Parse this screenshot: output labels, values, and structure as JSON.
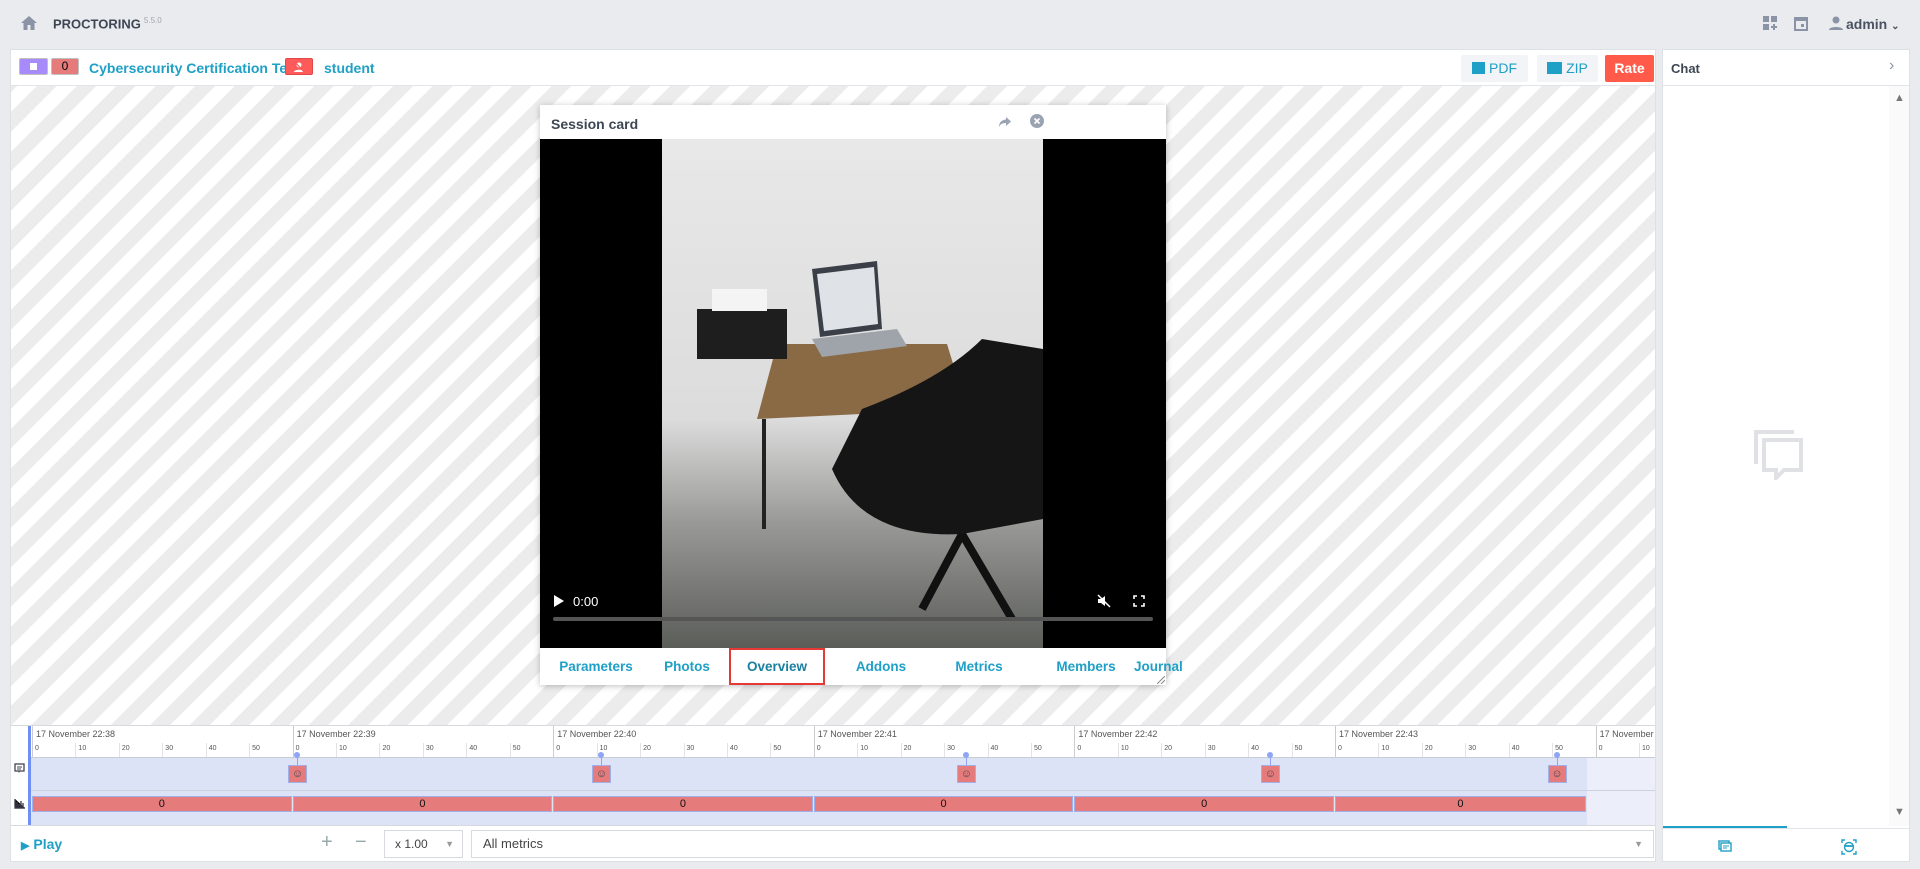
{
  "topbar": {
    "brand": "PROCTORING",
    "version": "5.5.0",
    "user": "admin"
  },
  "header": {
    "status_badge": "",
    "warnings_count": "0",
    "test_title": "Cybersecurity Certification Test",
    "student": "student",
    "pdf_label": "PDF",
    "zip_label": "ZIP",
    "rate_label": "Rate"
  },
  "session_card": {
    "title": "Session card",
    "video_time": "0:00",
    "tabs": [
      {
        "label": "Parameters"
      },
      {
        "label": "Photos"
      },
      {
        "label": "Overview",
        "active": true
      },
      {
        "label": "Addons"
      },
      {
        "label": "Metrics"
      },
      {
        "label": "Members"
      },
      {
        "label": "Journal"
      }
    ]
  },
  "timeline": {
    "minutes": [
      "17 November 22:38",
      "17 November 22:39",
      "17 November 22:40",
      "17 November 22:41",
      "17 November 22:42",
      "17 November 22:43",
      "17 November"
    ],
    "second_ticks": [
      "0",
      "10",
      "20",
      "30",
      "40",
      "50"
    ],
    "events": [
      {
        "minute": 1,
        "second": 1
      },
      {
        "minute": 2,
        "second": 11
      },
      {
        "minute": 3,
        "second": 35
      },
      {
        "minute": 4,
        "second": 45
      },
      {
        "minute": 5,
        "second": 51
      }
    ],
    "metric_values": [
      "0",
      "0",
      "0",
      "0",
      "0",
      "0"
    ],
    "session_end": {
      "minute": 5,
      "second": 58
    },
    "colors": {
      "metric": "#e57b7b",
      "session": "#dde3f7",
      "event": "#e57b7b"
    }
  },
  "controls": {
    "play_label": "Play",
    "zoom_in": "+",
    "zoom_out": "−",
    "speed": "x 1.00",
    "metrics_filter": "All metrics"
  },
  "chat": {
    "title": "Chat"
  },
  "colors": {
    "accent": "#1fa0c6",
    "rate": "#ff5a4a",
    "badge_purple": "#a78bfa",
    "badge_red": "#e57b7b",
    "tab_highlight": "#e53935"
  }
}
